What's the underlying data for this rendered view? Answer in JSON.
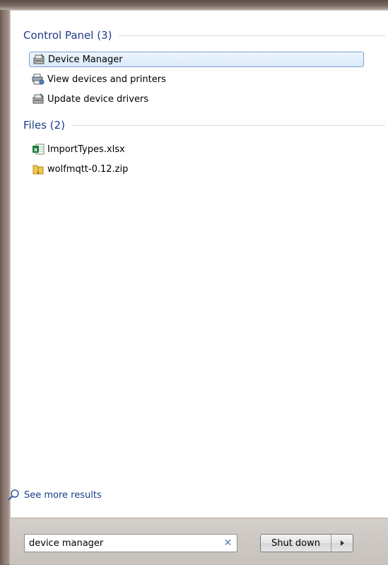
{
  "control_panel": {
    "header": "Control Panel (3)",
    "items": [
      {
        "label": "Device Manager",
        "icon": "device-manager-icon",
        "selected": true
      },
      {
        "label": "View devices and printers",
        "icon": "printer-icon",
        "selected": false
      },
      {
        "label": "Update device drivers",
        "icon": "device-driver-icon",
        "selected": false
      }
    ]
  },
  "files": {
    "header": "Files (2)",
    "items": [
      {
        "label": "ImportTypes.xlsx",
        "icon": "excel-file-icon"
      },
      {
        "label": "wolfmqtt-0.12.zip",
        "icon": "zip-folder-icon"
      }
    ]
  },
  "see_more": {
    "label": "See more results",
    "icon": "search-icon"
  },
  "search": {
    "value": "device manager",
    "clear_icon": "close-icon"
  },
  "shutdown": {
    "label": "Shut down",
    "arrow_icon": "chevron-right-icon"
  },
  "colors": {
    "header_text": "#1e3b8c",
    "selection_border": "#7da2ce",
    "link_text": "#1a3c8a"
  }
}
